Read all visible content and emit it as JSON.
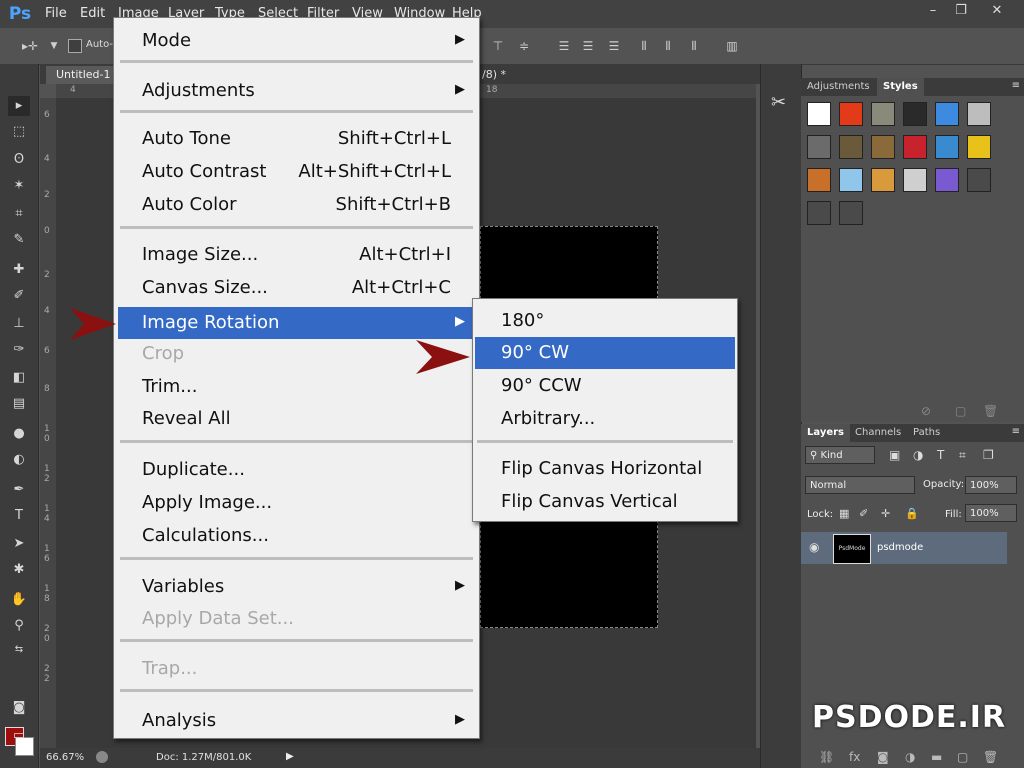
{
  "app": {
    "logo": "Ps",
    "menubar": [
      "File",
      "Edit",
      "Image",
      "Layer",
      "Type",
      "Select",
      "Filter",
      "View",
      "Window",
      "Help"
    ],
    "window_buttons": [
      "–",
      "❐",
      "✕"
    ]
  },
  "options": {
    "auto_select_label": "Auto-"
  },
  "document": {
    "tab_title": "Untitled-1",
    "tab2_title": "/8) *",
    "zoom": "66.67%",
    "doc_size": "Doc: 1.27M/801.0K"
  },
  "rulers": {
    "horizontal": [
      "4",
      "18"
    ],
    "vertical": [
      "6",
      "4",
      "2",
      "0",
      "2",
      "4",
      "6",
      "8",
      "1 0",
      "1 2",
      "1 4",
      "1 6",
      "1 8",
      "2 0",
      "2 2"
    ]
  },
  "image_menu": {
    "items": [
      {
        "label": "Mode",
        "shortcut": "",
        "submenu": true,
        "disabled": false
      },
      {
        "label": "Adjustments",
        "shortcut": "",
        "submenu": true,
        "disabled": false
      },
      {
        "label": "Auto Tone",
        "shortcut": "Shift+Ctrl+L",
        "submenu": false,
        "disabled": false
      },
      {
        "label": "Auto Contrast",
        "shortcut": "Alt+Shift+Ctrl+L",
        "submenu": false,
        "disabled": false
      },
      {
        "label": "Auto Color",
        "shortcut": "Shift+Ctrl+B",
        "submenu": false,
        "disabled": false
      },
      {
        "label": "Image Size...",
        "shortcut": "Alt+Ctrl+I",
        "submenu": false,
        "disabled": false
      },
      {
        "label": "Canvas Size...",
        "shortcut": "Alt+Ctrl+C",
        "submenu": false,
        "disabled": false
      },
      {
        "label": "Image Rotation",
        "shortcut": "",
        "submenu": true,
        "disabled": false,
        "highlighted": true
      },
      {
        "label": "Crop",
        "shortcut": "",
        "submenu": false,
        "disabled": true
      },
      {
        "label": "Trim...",
        "shortcut": "",
        "submenu": false,
        "disabled": false
      },
      {
        "label": "Reveal All",
        "shortcut": "",
        "submenu": false,
        "disabled": false
      },
      {
        "label": "Duplicate...",
        "shortcut": "",
        "submenu": false,
        "disabled": false
      },
      {
        "label": "Apply Image...",
        "shortcut": "",
        "submenu": false,
        "disabled": false
      },
      {
        "label": "Calculations...",
        "shortcut": "",
        "submenu": false,
        "disabled": false
      },
      {
        "label": "Variables",
        "shortcut": "",
        "submenu": true,
        "disabled": false
      },
      {
        "label": "Apply Data Set...",
        "shortcut": "",
        "submenu": false,
        "disabled": true
      },
      {
        "label": "Trap...",
        "shortcut": "",
        "submenu": false,
        "disabled": true
      },
      {
        "label": "Analysis",
        "shortcut": "",
        "submenu": true,
        "disabled": false
      }
    ]
  },
  "rotation_submenu": {
    "items": [
      {
        "label": "180°",
        "highlighted": false
      },
      {
        "label": "90° CW",
        "highlighted": true
      },
      {
        "label": "90° CCW",
        "highlighted": false
      },
      {
        "label": "Arbitrary...",
        "highlighted": false
      },
      {
        "label": "Flip Canvas Horizontal",
        "highlighted": false
      },
      {
        "label": "Flip Canvas Vertical",
        "highlighted": false
      }
    ]
  },
  "styles_panel": {
    "tabs": [
      "Adjustments",
      "Styles"
    ],
    "active_tab": "Styles",
    "swatch_colors": [
      "#ffffff",
      "#e33b1a",
      "#8a8a7a",
      "#2a2a2a",
      "#3d8be0",
      "#bdbdbd",
      "#6b6b6b",
      "#6b5a3a",
      "#8a6a3a",
      "#c8232c",
      "#3a8ad0",
      "#e6c21a",
      "#c8702a",
      "#8fc6ea",
      "#d89a3a",
      "#cfcfcf",
      "#7a5ad0",
      "#4a4a4a",
      "#4a4a4a",
      "#4a4a4a"
    ]
  },
  "layers_panel": {
    "tabs": [
      "Layers",
      "Channels",
      "Paths"
    ],
    "active_tab": "Layers",
    "filter_kind": "Kind",
    "blend_mode": "Normal",
    "opacity_label": "Opacity:",
    "opacity_value": "100%",
    "lock_label": "Lock:",
    "fill_label": "Fill:",
    "fill_value": "100%",
    "layer_name": "psdmode",
    "layer_thumb_text": "PsdMode"
  },
  "watermark": "PSDODE.IR",
  "colors": {
    "highlight": "#3469c5",
    "foreground": "#a00d0d",
    "arrow": "#8b1010"
  }
}
